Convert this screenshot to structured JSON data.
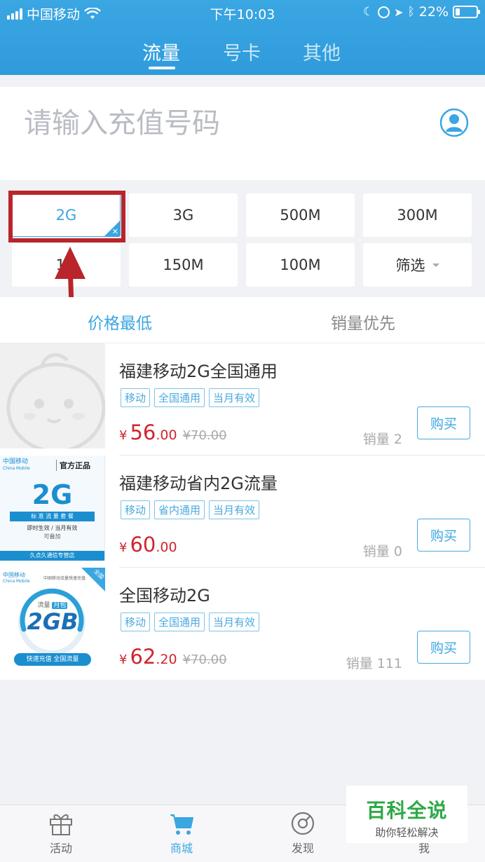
{
  "status_bar": {
    "carrier": "中国移动",
    "time": "下午10:03",
    "battery": "22%",
    "battery_level": 0.22
  },
  "top_tabs": [
    {
      "label": "流量",
      "active": true
    },
    {
      "label": "号卡",
      "active": false
    },
    {
      "label": "其他",
      "active": false
    }
  ],
  "search": {
    "placeholder": "请输入充值号码"
  },
  "filters": [
    {
      "label": "2G",
      "selected": true
    },
    {
      "label": "3G"
    },
    {
      "label": "500M"
    },
    {
      "label": "300M"
    },
    {
      "label": "1G"
    },
    {
      "label": "150M"
    },
    {
      "label": "100M"
    },
    {
      "label": "筛选"
    }
  ],
  "sort_tabs": [
    {
      "label": "价格最低",
      "active": true
    },
    {
      "label": "销量优先",
      "active": false
    }
  ],
  "products": [
    {
      "title": "福建移动2G全国通用",
      "tags": [
        "移动",
        "全国通用",
        "当月有效"
      ],
      "currency": "¥",
      "price_int": "56",
      "price_dec": ".00",
      "original_price": "¥70.00",
      "sales": "销量 2",
      "buy_label": "购买",
      "image": "placeholder-mascot"
    },
    {
      "title": "福建移动省内2G流量",
      "tags": [
        "移动",
        "省内通用",
        "当月有效"
      ],
      "currency": "¥",
      "price_int": "60",
      "price_dec": ".00",
      "original_price": "",
      "sales": "销量 0",
      "buy_label": "购买",
      "image": {
        "brand": "中国移动",
        "brand_en": "China Mobile",
        "badge": "官方正品",
        "big": "2G",
        "band": "标 准 流 量 套 餐",
        "line1": "即时生效 / 当月有效",
        "line2": "可叠加",
        "footer": "久点久通信专营店"
      }
    },
    {
      "title": "全国移动2G",
      "tags": [
        "移动",
        "全国通用",
        "当月有效"
      ],
      "currency": "¥",
      "price_int": "62",
      "price_dec": ".20",
      "original_price": "¥70.00",
      "sales": "销量 111",
      "buy_label": "购买",
      "image": {
        "brand": "中国移动",
        "brand_en": "China Mobile",
        "subtitle": "中国移动流量快速充值",
        "corner": "全国",
        "label_top": "流量",
        "label_tag": "月包",
        "big": "2GB",
        "footer": "快速充值 全国流量"
      }
    }
  ],
  "bottom_nav": [
    {
      "label": "活动",
      "icon": "gift-icon",
      "active": false
    },
    {
      "label": "商城",
      "icon": "cart-icon",
      "active": true
    },
    {
      "label": "发现",
      "icon": "compass-icon",
      "active": false
    },
    {
      "label": "我",
      "icon": "user-icon",
      "active": false
    }
  ],
  "watermark": {
    "main": "百科全说",
    "sub": "助你轻松解决"
  },
  "colors": {
    "accent": "#3aa6e2",
    "price": "#d0252d",
    "highlight": "#b9252b"
  }
}
